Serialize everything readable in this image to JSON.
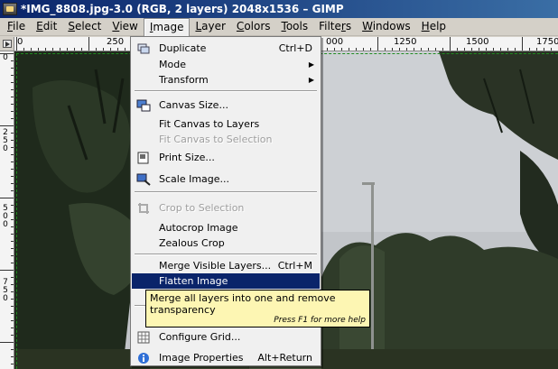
{
  "window": {
    "title": "*IMG_8808.jpg-3.0 (RGB, 2 layers) 2048x1536 – GIMP"
  },
  "menubar": [
    {
      "label": "File",
      "mn": "F",
      "rest": "ile"
    },
    {
      "label": "Edit",
      "mn": "E",
      "rest": "dit"
    },
    {
      "label": "Select",
      "mn": "S",
      "rest": "elect"
    },
    {
      "label": "View",
      "mn": "V",
      "rest": "iew"
    },
    {
      "label": "Image",
      "mn": "I",
      "rest": "mage"
    },
    {
      "label": "Layer",
      "mn": "L",
      "rest": "ayer"
    },
    {
      "label": "Colors",
      "mn": "C",
      "rest": "olors"
    },
    {
      "label": "Tools",
      "mn": "T",
      "rest": "ools"
    },
    {
      "label": "Filters",
      "mn": "r",
      "pre": "Filte",
      "rest": "s"
    },
    {
      "label": "Windows",
      "mn": "W",
      "rest": "indows"
    },
    {
      "label": "Help",
      "mn": "H",
      "rest": "elp"
    }
  ],
  "ruler": {
    "h_labels": [
      "0",
      "250",
      "000",
      "1250",
      "1500",
      "1750"
    ],
    "v_labels": [
      "0",
      "250",
      "500",
      "750"
    ]
  },
  "image_menu": {
    "items": [
      {
        "label": "Duplicate",
        "shortcut": "Ctrl+D",
        "icon": "duplicate-icon"
      },
      {
        "label": "Mode",
        "submenu": true
      },
      {
        "label": "Transform",
        "submenu": true
      },
      {
        "label": "Canvas Size...",
        "icon": "canvas-size-icon"
      },
      {
        "label": "Fit Canvas to Layers"
      },
      {
        "label": "Fit Canvas to Selection",
        "disabled": true
      },
      {
        "label": "Print Size...",
        "icon": "print-size-icon"
      },
      {
        "label": "Scale Image...",
        "icon": "scale-image-icon"
      },
      {
        "label": "Crop to Selection",
        "disabled": true,
        "icon": "crop-icon"
      },
      {
        "label": "Autocrop Image"
      },
      {
        "label": "Zealous Crop"
      },
      {
        "label": "Merge Visible Layers...",
        "shortcut": "Ctrl+M"
      },
      {
        "label": "Flatten Image",
        "highlighted": true
      },
      {
        "label": "Configure Grid...",
        "icon": "grid-icon"
      },
      {
        "label": "Image Properties",
        "shortcut": "Alt+Return",
        "icon": "info-icon"
      }
    ]
  },
  "tooltip": {
    "text": "Merge all layers into one and remove transparency",
    "hint": "Press F1 for more help"
  },
  "colors": {
    "title_bar": "#0a246a",
    "highlight": "#0a246a",
    "tooltip_bg": "#fdf6b3"
  }
}
